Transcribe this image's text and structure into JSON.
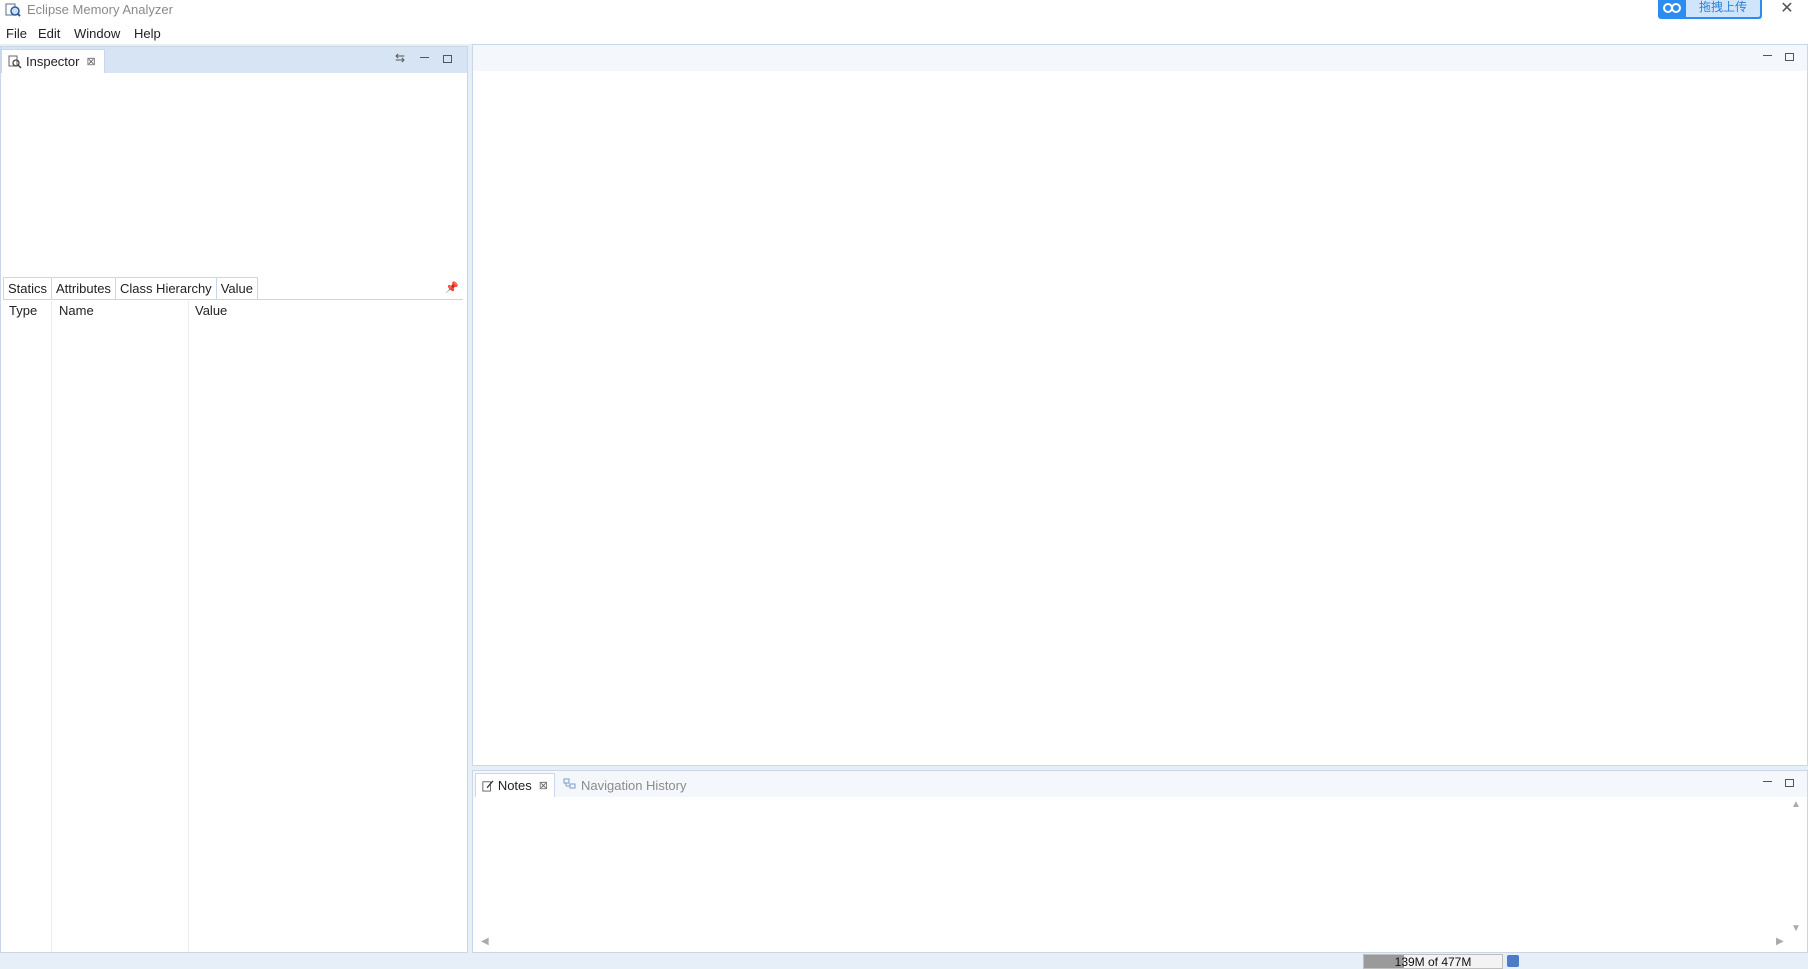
{
  "window": {
    "title": "Eclipse Memory Analyzer",
    "upload_label": "拖拽上传",
    "close_glyph": "✕"
  },
  "menu": {
    "items": [
      "File",
      "Edit",
      "Window",
      "Help"
    ]
  },
  "inspector": {
    "tab_label": "Inspector",
    "subtabs": [
      "Statics",
      "Attributes",
      "Class Hierarchy",
      "Value"
    ],
    "columns": [
      "Type",
      "Name",
      "Value"
    ]
  },
  "bottom_panel": {
    "tabs": [
      "Notes",
      "Navigation History"
    ]
  },
  "status": {
    "heap_label": "139M of 477M",
    "heap_fraction": 0.29
  },
  "colors": {
    "accent": "#2c8cf0",
    "workbench_bg": "#e6eef8"
  }
}
